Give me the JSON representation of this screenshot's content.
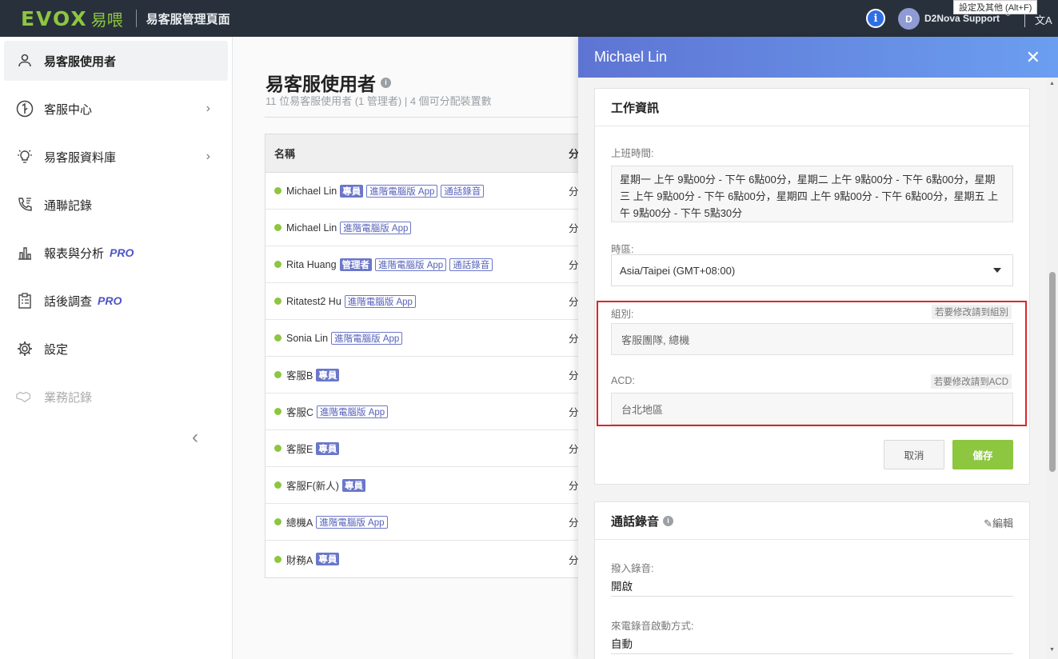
{
  "topbar": {
    "logo_text": "EVOX",
    "logo_cn": "易喂",
    "app_title": "易客服管理頁面",
    "info_label": "i",
    "user_initial": "D",
    "user_name": "D2Nova Support",
    "tooltip": "設定及其他 (Alt+F)",
    "lang_icon_text": "文A"
  },
  "sidebar": {
    "items": [
      {
        "label": "易客服使用者",
        "icon": "user-icon",
        "active": true
      },
      {
        "label": "客服中心",
        "icon": "headset-icon",
        "chevron": true
      },
      {
        "label": "易客服資料庫",
        "icon": "bulb-icon",
        "chevron": true
      },
      {
        "label": "通聯記錄",
        "icon": "phone-log-icon"
      },
      {
        "label": "報表與分析",
        "icon": "bar-chart-icon",
        "pro": "PRO"
      },
      {
        "label": "話後調查",
        "icon": "clipboard-icon",
        "pro": "PRO"
      },
      {
        "label": "設定",
        "icon": "gear-icon"
      },
      {
        "label": "業務記錄",
        "icon": "handshake-icon",
        "disabled": true
      }
    ],
    "collapse_icon": "chevron-left-icon"
  },
  "main": {
    "title": "易客服使用者",
    "subtitle": "11 位易客服使用者 (1 管理者) | 4 個可分配裝置數",
    "table": {
      "col_name": "名稱",
      "col_2": "分",
      "rows": [
        {
          "name": "Michael Lin",
          "tags": [
            {
              "t": "專員",
              "s": true
            },
            {
              "t": "進階電腦版 App",
              "s": false
            },
            {
              "t": "通話錄音",
              "s": false
            }
          ],
          "col2": "分"
        },
        {
          "name": "Michael Lin",
          "tags": [
            {
              "t": "進階電腦版 App",
              "s": false
            }
          ],
          "col2": "分"
        },
        {
          "name": "Rita Huang",
          "tags": [
            {
              "t": "管理者",
              "s": true
            },
            {
              "t": "進階電腦版 App",
              "s": false
            },
            {
              "t": "通話錄音",
              "s": false
            }
          ],
          "col2": "分"
        },
        {
          "name": "Ritatest2 Hu",
          "tags": [
            {
              "t": "進階電腦版 App",
              "s": false
            }
          ],
          "col2": "分"
        },
        {
          "name": "Sonia Lin",
          "tags": [
            {
              "t": "進階電腦版 App",
              "s": false
            }
          ],
          "col2": "分"
        },
        {
          "name": "客服B",
          "tags": [
            {
              "t": "專員",
              "s": true
            }
          ],
          "col2": "分"
        },
        {
          "name": "客服C",
          "tags": [
            {
              "t": "進階電腦版 App",
              "s": false
            }
          ],
          "col2": "分"
        },
        {
          "name": "客服E",
          "tags": [
            {
              "t": "專員",
              "s": true
            }
          ],
          "col2": "分"
        },
        {
          "name": "客服F(新人)",
          "tags": [
            {
              "t": "專員",
              "s": true
            }
          ],
          "col2": "分"
        },
        {
          "name": "總機A",
          "tags": [
            {
              "t": "進階電腦版 App",
              "s": false
            }
          ],
          "col2": "分"
        },
        {
          "name": "財務A",
          "tags": [
            {
              "t": "專員",
              "s": true
            }
          ],
          "col2": "分"
        }
      ]
    }
  },
  "drawer": {
    "title": "Michael Lin",
    "work_info": {
      "title": "工作資訊",
      "hours_label": "上班時間:",
      "hours_value": "星期一 上午 9點00分 - 下午 6點00分，星期二 上午 9點00分 - 下午 6點00分，星期三 上午 9點00分 - 下午 6點00分，星期四 上午 9點00分 - 下午 6點00分，星期五 上午 9點00分 - 下午 5點30分",
      "tz_label": "時區:",
      "tz_value": "Asia/Taipei (GMT+08:00)",
      "group_label": "組別:",
      "group_link": "若要修改請到組別",
      "group_value": "客服團隊, 總機",
      "acd_label": "ACD:",
      "acd_link": "若要修改請到ACD",
      "acd_value": "台北地區",
      "cancel": "取消",
      "save": "儲存"
    },
    "recording": {
      "title": "通話錄音",
      "edit": "編輯",
      "incoming_label": "撥入錄音:",
      "incoming_value": "開啟",
      "trigger_label": "來電錄音啟動方式:",
      "trigger_value": "自動"
    }
  }
}
